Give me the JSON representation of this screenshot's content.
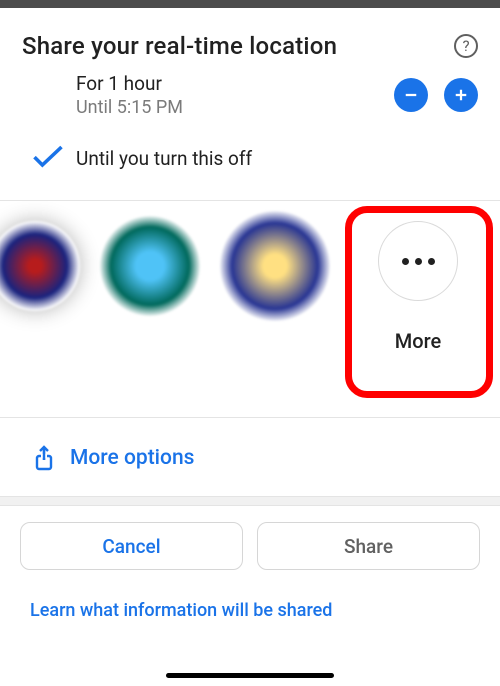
{
  "header": {
    "title": "Share your real-time location"
  },
  "duration": {
    "title": "For 1 hour",
    "subtitle": "Until 5:15 PM"
  },
  "until_off": {
    "label": "Until you turn this off"
  },
  "more": {
    "label": "More"
  },
  "more_options": {
    "label": "More options"
  },
  "buttons": {
    "cancel": "Cancel",
    "share": "Share"
  },
  "footer": {
    "learn": "Learn what information will be shared"
  },
  "icons": {
    "help": "?"
  }
}
